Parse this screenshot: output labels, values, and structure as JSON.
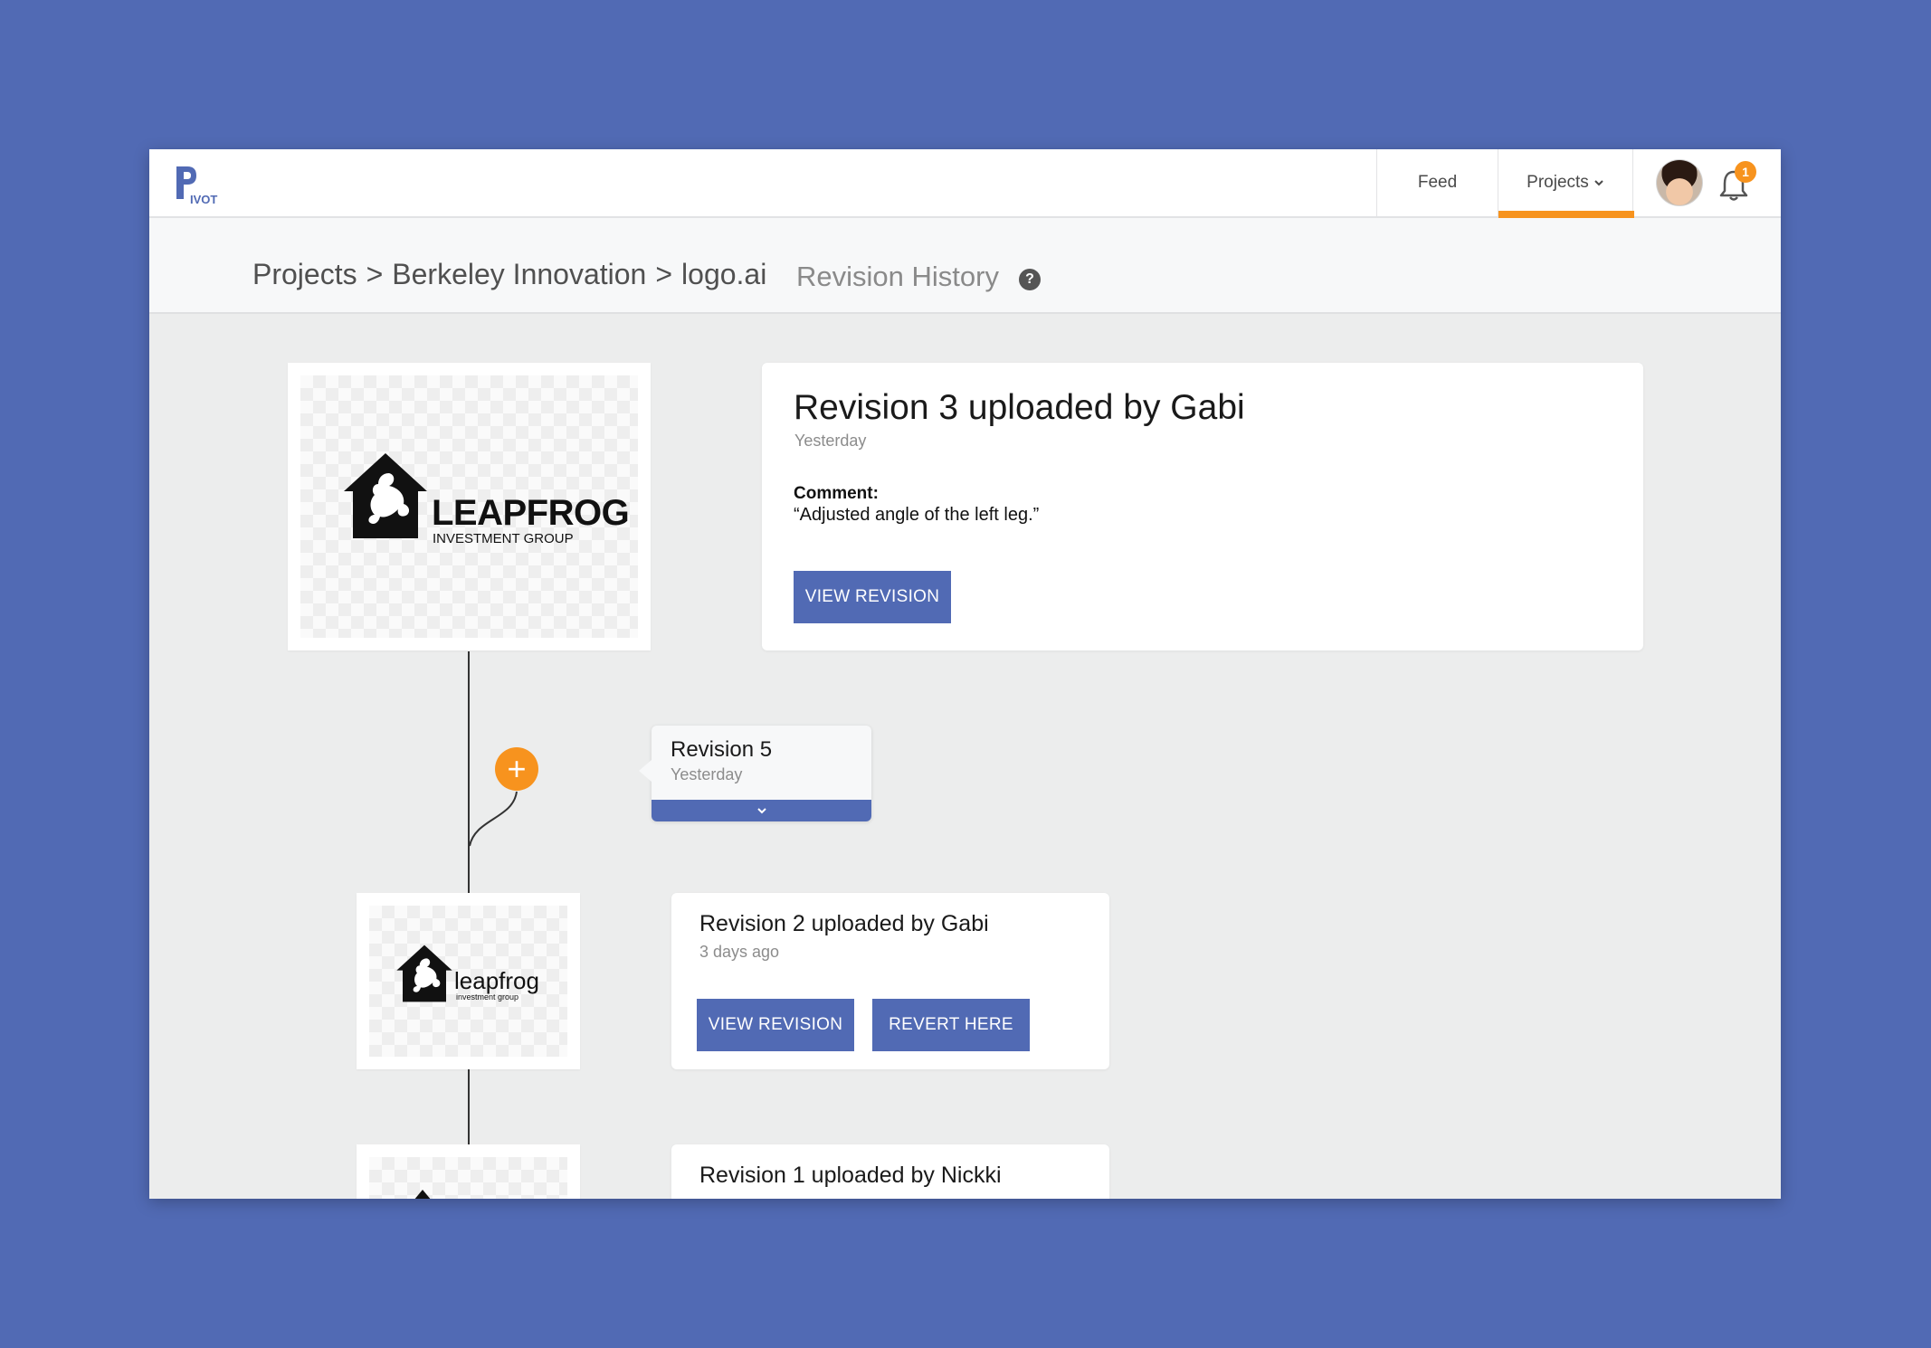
{
  "nav": {
    "logo_text": "IVOT",
    "feed": "Feed",
    "projects": "Projects",
    "notification_count": "1"
  },
  "header": {
    "crumb_projects": "Projects",
    "crumb_project": "Berkeley Innovation",
    "crumb_file": "logo.ai",
    "separator": ">",
    "title": "Revision History",
    "help": "?"
  },
  "revisions": [
    {
      "number": "Revision 3",
      "uploaded_by_text": " uploaded by ",
      "author": "Gabi",
      "time": "Yesterday",
      "comment_label": "Comment:",
      "comment": "“Adjusted angle of the left leg.”",
      "view_label": "VIEW REVISION",
      "logo_line1": "LEAPFROG",
      "logo_line2": "INVESTMENT GROUP"
    },
    {
      "number": "Revision 5",
      "time": "Yesterday"
    },
    {
      "number": "Revision 2",
      "uploaded_by_text": " uploaded by ",
      "author": "Gabi",
      "time": "3 days ago",
      "view_label": "VIEW REVISION",
      "revert_label": "REVERT HERE",
      "logo_line1": "leapfrog",
      "logo_line2": "investment group"
    },
    {
      "number": "Revision 1",
      "uploaded_by_text": " uploaded by ",
      "author": "Nickki"
    }
  ],
  "colors": {
    "accent": "#516ab4",
    "highlight": "#f7931e",
    "background": "#516ab4"
  }
}
